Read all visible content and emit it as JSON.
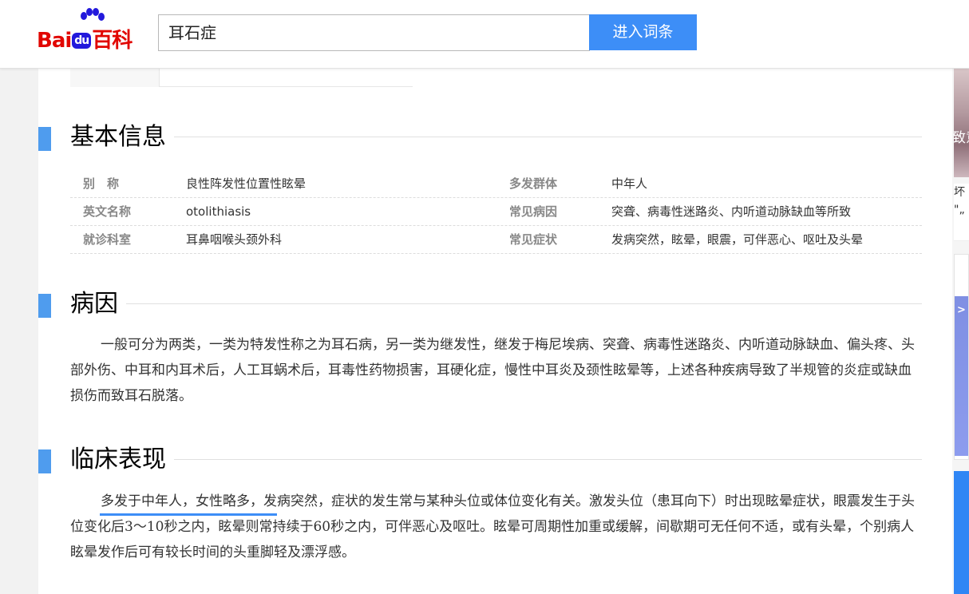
{
  "header": {
    "logo": {
      "bai": "Bai",
      "du": "du",
      "baike": "百科"
    },
    "search": {
      "value": "耳石症"
    },
    "enter_button": "进入词条"
  },
  "sections": {
    "basic": {
      "title": "基本信息"
    },
    "cause": {
      "title": "病因"
    },
    "clinical": {
      "title": "临床表现"
    }
  },
  "basic_info": {
    "rows": [
      {
        "k1": "别　称",
        "v1": "良性阵发性位置性眩晕",
        "k2": "多发群体",
        "v2": "中年人"
      },
      {
        "k1": "英文名称",
        "v1": "otolithiasis",
        "k2": "常见病因",
        "v2": "突聋、病毒性迷路炎、内听道动脉缺血等所致"
      },
      {
        "k1": "就诊科室",
        "v1": "耳鼻咽喉头颈外科",
        "k2": "常见症状",
        "v2": "发病突然，眩晕，眼震，可伴恶心、呕吐及头晕"
      }
    ]
  },
  "cause_text": "一般可分为两类，一类为特发性称之为耳石病，另一类为继发性，继发于梅尼埃病、突聋、病毒性迷路炎、内听道动脉缺血、偏头疼、头部外伤、中耳和内耳术后，人工耳蜗术后，耳毒性药物损害，耳硬化症，慢性中耳炎及颈性眩晕等，上述各种疾病导致了半规管的炎症或缺血损伤而致耳石脱落。",
  "clinical_text": "多发于中年人，女性略多，发病突然，症状的发生常与某种头位或体位变化有关。激发头位（患耳向下）时出现眩晕症状，眼震发生于头位变化后3～10秒之内，眩晕则常持续于60秒之内，可伴恶心及呕吐。眩晕可周期性加重或缓解，间歇期可无任何不适，或有头晕，个别病人眩晕发作后可有较长时间的头重脚轻及漂浮感。",
  "side": {
    "ad1_text": "致意",
    "ad_text_lines": [
      "坏",
      "\"„"
    ],
    "arrow": ">"
  },
  "colors": {
    "accent": "#3d8ef7",
    "section_bar": "#4f9cee",
    "logo_red": "#e10601",
    "logo_blue": "#2319dc"
  }
}
